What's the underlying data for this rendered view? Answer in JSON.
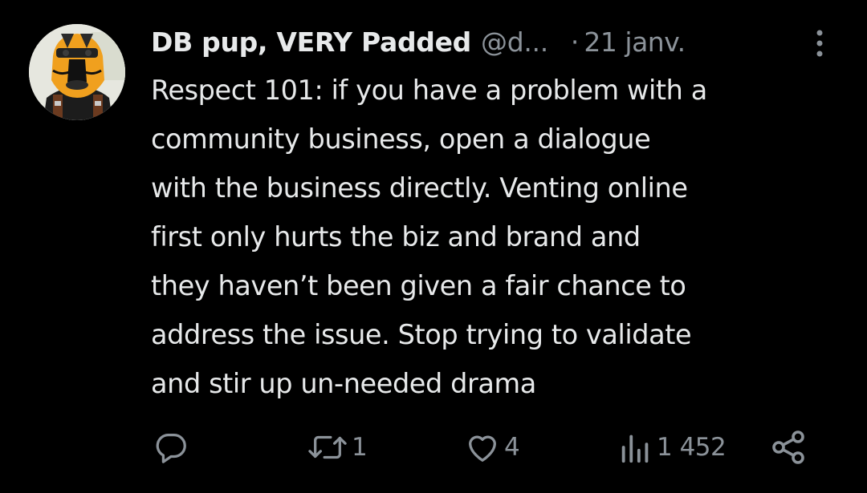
{
  "tweet": {
    "author_name": "DB pup, VERY Padded",
    "author_handle": "@d...",
    "separator": "·",
    "date": "21 janv.",
    "text": "Respect 101: if you have a problem with a\ncommunity business, open a dialogue\nwith the business directly. Venting online\nfirst only hurts the biz and brand and\nthey haven’t been given a fair chance to\naddress the issue. Stop trying to validate\nand stir up un-needed drama"
  },
  "actions": {
    "replies": "",
    "retweets": "1",
    "likes": "4",
    "views": "1 452"
  },
  "colors": {
    "background": "#000000",
    "primary_text": "#e7e9ea",
    "secondary_text": "#8b9299",
    "avatar_mask": "#f0a01e"
  },
  "icons": {
    "more": "more-vertical-icon",
    "reply": "reply-icon",
    "retweet": "retweet-icon",
    "like": "heart-icon",
    "views": "views-icon",
    "share": "share-icon"
  }
}
